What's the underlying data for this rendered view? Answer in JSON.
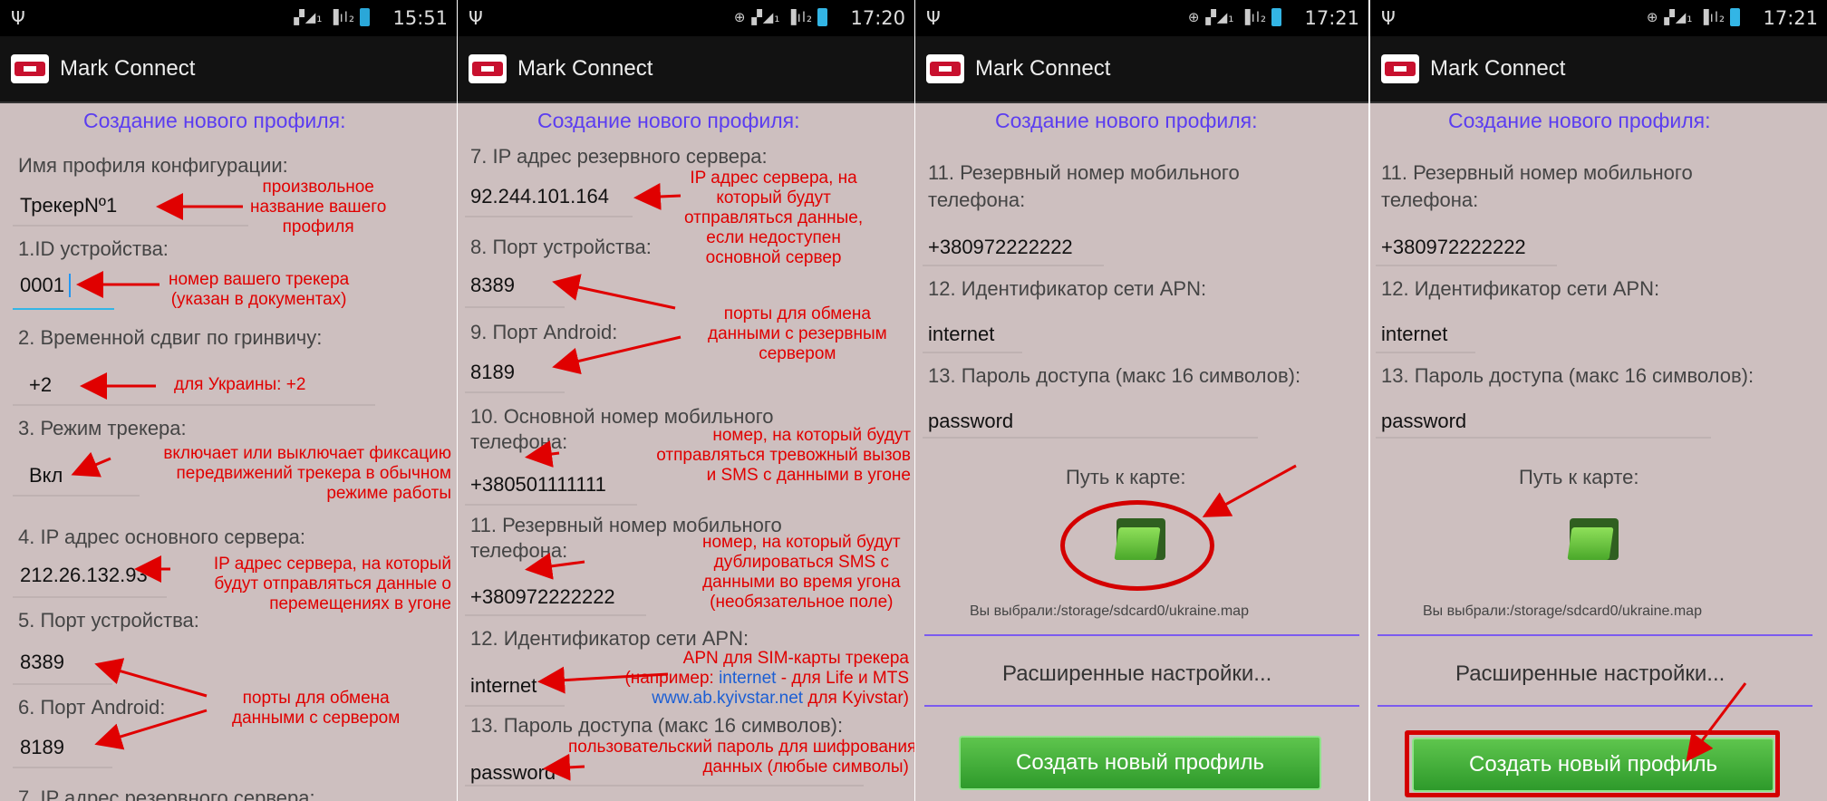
{
  "app": {
    "title": "Mark Connect"
  },
  "header_title": "Создание нового профиля:",
  "colors": {
    "background": "#cdbfbf",
    "header": "#5b3df0",
    "annotation": "#e00000",
    "button": "#3fae35"
  },
  "screens": [
    {
      "time": "15:51",
      "labels": {
        "profile_name": "Имя профиля конфигурации:",
        "device_id": "1.ID устройства:",
        "time_shift": "2. Временной сдвиг по гринвичу:",
        "tracker_mode": "3. Режим трекера:",
        "main_server_ip": "4. IP адрес основного сервера:",
        "device_port": "5. Порт устройства:",
        "android_port": "6. Порт Android:",
        "backup_server_ip": "7. IP адрес резервного сервера:"
      },
      "values": {
        "profile_name": "ТрекерNº1",
        "device_id": "0001",
        "time_shift": "+2",
        "tracker_mode": "Вкл",
        "main_server_ip": "212.26.132.93",
        "device_port": "8389",
        "android_port": "8189"
      },
      "annotations": {
        "profile_name": [
          "произвольное",
          "название вашего",
          "профиля"
        ],
        "device_id": [
          "номер вашего трекера",
          "(указан в документах)"
        ],
        "time_shift": [
          "для Украины: +2"
        ],
        "tracker_mode": [
          "включает или выключает фиксацию",
          "передвижений трекера в обычном",
          "режиме работы"
        ],
        "main_server_ip": [
          "IP адрес сервера, на который",
          "будут отправляться данные о",
          "перемещениях в угоне"
        ],
        "ports": [
          "порты для обмена",
          "данными с сервером"
        ]
      }
    },
    {
      "time": "17:20",
      "labels": {
        "backup_server_ip": "7. IP адрес резервного сервера:",
        "device_port": "8. Порт устройства:",
        "android_port": "9. Порт Android:",
        "main_phone_1": "10. Основной номер мобильного",
        "main_phone_2": "телефона:",
        "backup_phone_1": "11. Резервный номер мобильного",
        "backup_phone_2": "телефона:",
        "apn": "12. Идентификатор сети APN:",
        "password": "13. Пароль доступа (макс 16 символов):"
      },
      "values": {
        "backup_server_ip": "92.244.101.164",
        "device_port": "8389",
        "android_port": "8189",
        "main_phone": "+380501111111",
        "backup_phone": "+380972222222",
        "apn": "internet",
        "password": "password"
      },
      "annotations": {
        "backup_server_ip": [
          "IP адрес сервера, на",
          "который будут",
          "отправляться данные,",
          "если недоступен",
          "основной сервер"
        ],
        "ports": [
          "порты для обмена",
          "данными с резервным",
          "сервером"
        ],
        "main_phone": [
          "номер, на который будут",
          "отправляться тревожный вызов",
          "и SMS с данными в угоне"
        ],
        "backup_phone": [
          "номер, на который будут",
          "дублироваться SMS с",
          "данными во время угона",
          "(необязательное поле)"
        ],
        "apn_line1": "APN для SIM-карты трекера",
        "apn_line2_pre": "(например: ",
        "apn_line2_link": "internet",
        "apn_line2_post": " - для Life и MTS",
        "apn_line3_link": "www.ab.kyivstar.net",
        "apn_line3_post": " для Kyivstar)",
        "password": [
          "пользовательский пароль для шифрования",
          "данных (любые символы)"
        ]
      }
    },
    {
      "time": "17:21",
      "labels": {
        "backup_phone_1": "11. Резервный номер мобильного",
        "backup_phone_2": "телефона:",
        "apn": "12. Идентификатор сети APN:",
        "password": "13. Пароль доступа (макс 16 символов):",
        "map_path": "Путь к карте:",
        "selected": "Вы выбрали:/storage/sdcard0/ukraine.map",
        "advanced": "Расширенные настройки...",
        "create": "Создать новый профиль"
      },
      "values": {
        "backup_phone": "+380972222222",
        "apn": "internet",
        "password": "password"
      }
    },
    {
      "time": "17:21",
      "labels": {
        "backup_phone_1": "11. Резервный номер мобильного",
        "backup_phone_2": "телефона:",
        "apn": "12. Идентификатор сети APN:",
        "password": "13. Пароль доступа (макс 16 символов):",
        "map_path": "Путь к карте:",
        "selected": "Вы выбрали:/storage/sdcard0/ukraine.map",
        "advanced": "Расширенные настройки...",
        "create": "Создать новый профиль"
      },
      "values": {
        "backup_phone": "+380972222222",
        "apn": "internet",
        "password": "password"
      }
    }
  ]
}
